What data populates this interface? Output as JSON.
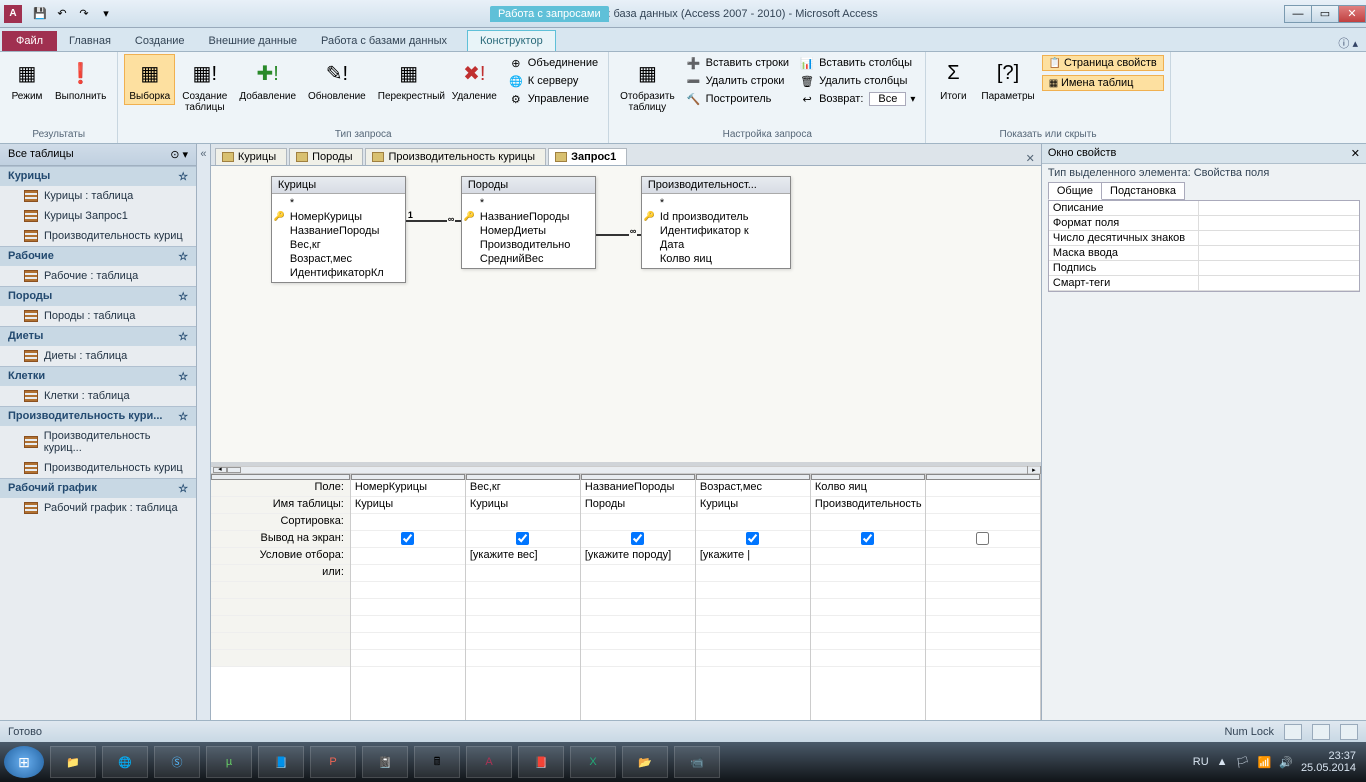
{
  "titlebar": {
    "app_icon": "A",
    "context_tab_group": "Работа с запросами",
    "title": "Ptitsefabrika (1) : база данных (Access 2007 - 2010)  -  Microsoft Access"
  },
  "ribbon_tabs": {
    "file": "Файл",
    "tabs": [
      "Главная",
      "Создание",
      "Внешние данные",
      "Работа с базами данных"
    ],
    "context_tab": "Конструктор"
  },
  "ribbon": {
    "g1": {
      "label": "Результаты",
      "view": "Режим",
      "run": "Выполнить"
    },
    "g2": {
      "label": "Тип запроса",
      "select": "Выборка",
      "maketable": "Создание\nтаблицы",
      "append": "Добавление",
      "update": "Обновление",
      "crosstab": "Перекрестный",
      "delete": "Удаление",
      "union": "Объединение",
      "passthrough": "К серверу",
      "datadef": "Управление"
    },
    "g3": {
      "label": "Настройка запроса",
      "showtable": "Отобразить\nтаблицу",
      "insrow": "Вставить строки",
      "delrow": "Удалить строки",
      "builder": "Построитель",
      "inscol": "Вставить столбцы",
      "delcol": "Удалить столбцы",
      "return": "Возврат:",
      "return_val": "Все"
    },
    "g4": {
      "label": "Показать или скрыть",
      "totals": "Итоги",
      "params": "Параметры",
      "propsheet": "Страница свойств",
      "tablenames": "Имена таблиц"
    }
  },
  "navpane": {
    "header": "Все таблицы",
    "cats": [
      {
        "name": "Курицы",
        "items": [
          "Курицы : таблица",
          "Курицы Запрос1",
          "Производительность куриц"
        ]
      },
      {
        "name": "Рабочие",
        "items": [
          "Рабочие : таблица"
        ]
      },
      {
        "name": "Породы",
        "items": [
          "Породы : таблица"
        ]
      },
      {
        "name": "Диеты",
        "items": [
          "Диеты : таблица"
        ]
      },
      {
        "name": "Клетки",
        "items": [
          "Клетки : таблица"
        ]
      },
      {
        "name": "Производительность кури...",
        "items": [
          "Производительность куриц...",
          "Производительность куриц"
        ]
      },
      {
        "name": "Рабочий график",
        "items": [
          "Рабочий график : таблица"
        ]
      }
    ]
  },
  "doc_tabs": {
    "tabs": [
      "Курицы",
      "Породы",
      "Производительность курицы",
      "Запрос1"
    ],
    "active": 3
  },
  "diagram": {
    "t1": {
      "title": "Курицы",
      "fields": [
        "*",
        "НомерКурицы",
        "НазваниеПороды",
        "Вес,кг",
        "Возраст,мес",
        "ИдентификаторКл"
      ],
      "key_idx": 1
    },
    "t2": {
      "title": "Породы",
      "fields": [
        "*",
        "НазваниеПороды",
        "НомерДиеты",
        "Производительно",
        "СреднийВес"
      ],
      "key_idx": 1
    },
    "t3": {
      "title": "Производительност...",
      "fields": [
        "*",
        "Id производитель",
        "Идентификатор к",
        "Дата",
        "Колво яиц"
      ],
      "key_idx": 1
    }
  },
  "grid": {
    "labels": [
      "Поле:",
      "Имя таблицы:",
      "Сортировка:",
      "Вывод на экран:",
      "Условие отбора:",
      "или:"
    ],
    "cols": [
      {
        "field": "НомерКурицы",
        "table": "Курицы",
        "sort": "",
        "show": true,
        "crit": "",
        "or": ""
      },
      {
        "field": "Вес,кг",
        "table": "Курицы",
        "sort": "",
        "show": true,
        "crit": "[укажите вес]",
        "or": ""
      },
      {
        "field": "НазваниеПороды",
        "table": "Породы",
        "sort": "",
        "show": true,
        "crit": "[укажите породу]",
        "or": ""
      },
      {
        "field": "Возраст,мес",
        "table": "Курицы",
        "sort": "",
        "show": true,
        "crit": "[укажите |",
        "or": ""
      },
      {
        "field": "Колво яиц",
        "table": "Производительность",
        "sort": "",
        "show": true,
        "crit": "",
        "or": ""
      },
      {
        "field": "",
        "table": "",
        "sort": "",
        "show": false,
        "crit": "",
        "or": ""
      }
    ]
  },
  "propsheet": {
    "title": "Окно свойств",
    "subtitle": "Тип выделенного элемента:  Свойства поля",
    "tabs": [
      "Общие",
      "Подстановка"
    ],
    "rows": [
      "Описание",
      "Формат поля",
      "Число десятичных знаков",
      "Маска ввода",
      "Подпись",
      "Смарт-теги"
    ]
  },
  "statusbar": {
    "ready": "Готово",
    "numlock": "Num Lock"
  },
  "taskbar": {
    "lang": "RU",
    "time": "23:37",
    "date": "25.05.2014"
  }
}
